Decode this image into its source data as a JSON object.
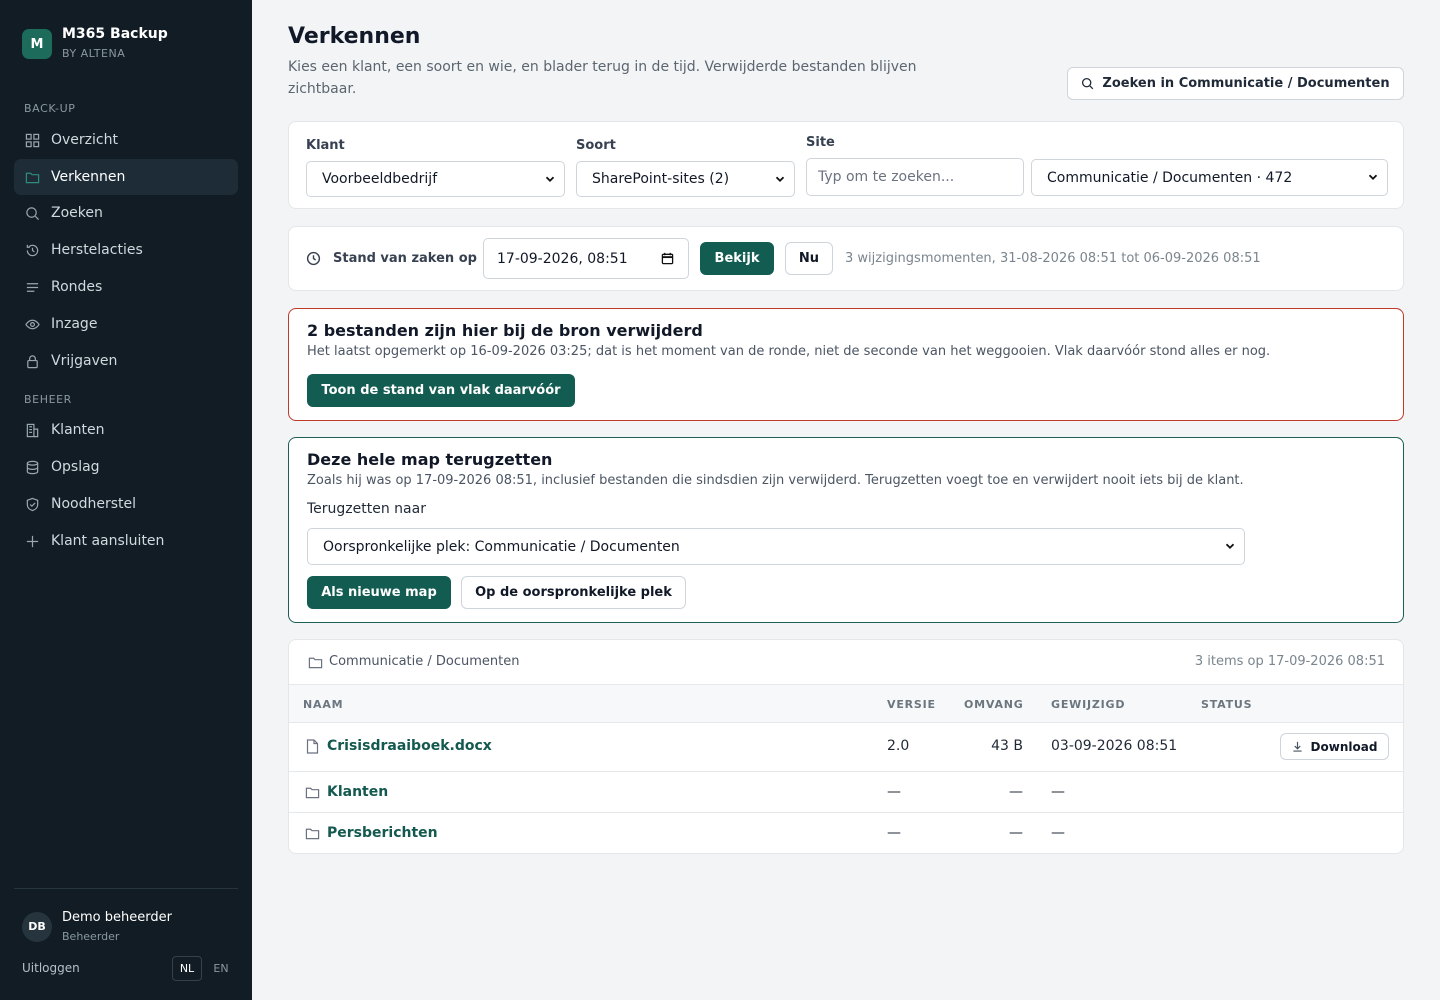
{
  "app": {
    "title": "M365 Backup",
    "subtitle": "BY ALTENA",
    "logo_letter": "M"
  },
  "sidebar": {
    "section_backup": "BACK-UP",
    "section_beheer": "BEHEER",
    "items": [
      {
        "label": "Overzicht",
        "icon": "grid-icon"
      },
      {
        "label": "Verkennen",
        "icon": "folder-icon",
        "active": true
      },
      {
        "label": "Zoeken",
        "icon": "search-icon"
      },
      {
        "label": "Herstelacties",
        "icon": "history-icon"
      },
      {
        "label": "Rondes",
        "icon": "list-icon"
      },
      {
        "label": "Inzage",
        "icon": "eye-icon"
      },
      {
        "label": "Vrijgaven",
        "icon": "lock-icon"
      },
      {
        "label": "Klanten",
        "icon": "building-icon"
      },
      {
        "label": "Opslag",
        "icon": "database-icon"
      },
      {
        "label": "Noodherstel",
        "icon": "shield-icon"
      },
      {
        "label": "Klant aansluiten",
        "icon": "plus-icon"
      }
    ],
    "user": {
      "initials": "DB",
      "name": "Demo beheerder",
      "role": "Beheerder"
    },
    "logout": "Uitloggen",
    "lang_nl": "NL",
    "lang_en": "EN"
  },
  "header": {
    "title": "Verkennen",
    "subtitle": "Kies een klant, een soort en wie, en blader terug in de tijd. Verwijderde bestanden blijven zichtbaar.",
    "search_button": "Zoeken in Communicatie / Documenten"
  },
  "filters": {
    "klant_label": "Klant",
    "klant_value": "Voorbeeldbedrijf",
    "soort_label": "Soort",
    "soort_value": "SharePoint-sites (2)",
    "site_label": "Site",
    "site_placeholder": "Typ om te zoeken...",
    "library_value": "Communicatie / Documenten · 472"
  },
  "time": {
    "label": "Stand van zaken op",
    "value": "17-09-2026, 08:51",
    "view_button": "Bekijk",
    "now_button": "Nu",
    "info": "3 wijzigingsmomenten, 31-08-2026 08:51 tot 06-09-2026 08:51"
  },
  "deleted_alert": {
    "title": "2 bestanden zijn hier bij de bron verwijderd",
    "text": "Het laatst opgemerkt op 16-09-2026 03:25; dat is het moment van de ronde, niet de seconde van het weggooien. Vlak daarvóór stond alles er nog.",
    "button": "Toon de stand van vlak daarvóór"
  },
  "restore": {
    "title": "Deze hele map terugzetten",
    "text": "Zoals hij was op 17-09-2026 08:51, inclusief bestanden die sindsdien zijn verwijderd. Terugzetten voegt toe en verwijdert nooit iets bij de klant.",
    "target_label": "Terugzetten naar",
    "target_value": "Oorspronkelijke plek: Communicatie / Documenten",
    "new_folder_button": "Als nieuwe map",
    "original_button": "Op de oorspronkelijke plek"
  },
  "browser": {
    "path": "Communicatie / Documenten",
    "summary": "3 items op 17-09-2026 08:51",
    "columns": [
      "NAAM",
      "VERSIE",
      "OMVANG",
      "GEWIJZIGD",
      "STATUS"
    ],
    "rows": [
      {
        "type": "file",
        "name": "Crisisdraaiboek.docx",
        "version": "2.0",
        "size": "43 B",
        "modified": "03-09-2026 08:51",
        "action": "Download"
      },
      {
        "type": "folder",
        "name": "Klanten",
        "version": "—",
        "size": "—",
        "modified": "—"
      },
      {
        "type": "folder",
        "name": "Persberichten",
        "version": "—",
        "size": "—",
        "modified": "—"
      }
    ]
  },
  "colors": {
    "sidebar_bg": "#111c24",
    "primary": "#135c52",
    "alert_border": "#c0392b"
  }
}
